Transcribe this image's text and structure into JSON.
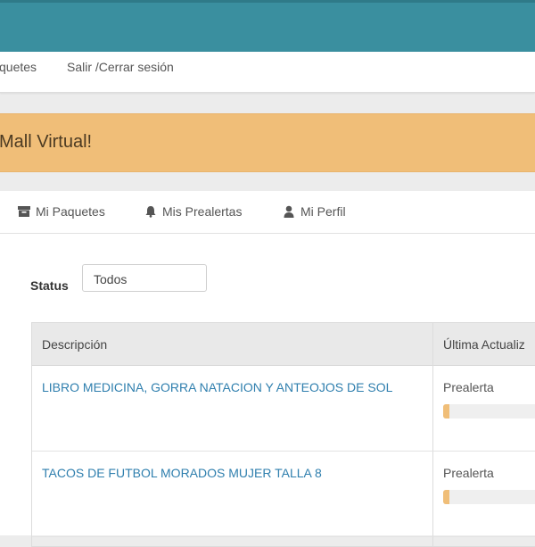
{
  "nav": {
    "packages_label": "quetes",
    "logout_label": "Salir /Cerrar sesión"
  },
  "banner": {
    "text": "Mall Virtual!"
  },
  "tabs": [
    {
      "label": "Mi Paquetes",
      "icon": "archive-icon"
    },
    {
      "label": "Mis Prealertas",
      "icon": "bell-icon"
    },
    {
      "label": "Mi Perfil",
      "icon": "user-icon"
    }
  ],
  "filter": {
    "label": "Status",
    "selected": "Todos"
  },
  "table": {
    "headers": [
      "Descripción",
      "Última Actualiz"
    ],
    "rows": [
      {
        "description": "LIBRO MEDICINA, GORRA NATACION Y ANTEOJOS DE SOL",
        "status": "Prealerta",
        "progress": 0.05
      },
      {
        "description": "TACOS DE FUTBOL MORADOS MUJER TALLA 8",
        "status": "Prealerta",
        "progress": 0.05
      }
    ]
  },
  "colors": {
    "topbar": "#3a8f9f",
    "banner": "#f0be78",
    "link": "#2f7fae",
    "progress": "#f0be78"
  }
}
